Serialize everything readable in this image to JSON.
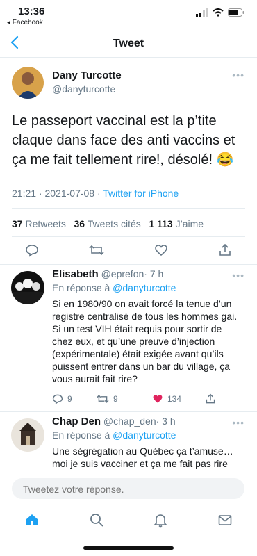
{
  "status": {
    "time": "13:36",
    "back_app": "◂ Facebook"
  },
  "nav": {
    "title": "Tweet"
  },
  "tweet": {
    "author_name": "Dany Turcotte",
    "author_handle": "@danyturcotte",
    "text": "Le passeport vaccinal est la p’tite claque dans face des anti vaccins et ça me fait tellement rire!, désolé! 😂",
    "timestamp": "21:21 · 2021-07-08 · ",
    "source": "Twitter for iPhone",
    "retweets_count": "37",
    "retweets_label": "Retweets",
    "quotes_count": "36",
    "quotes_label": "Tweets cités",
    "likes_count": "1 113",
    "likes_label": "J’aime"
  },
  "replies": [
    {
      "name": "Elisabeth",
      "handle": "@eprefon",
      "time": "· 7 h",
      "in_reply_prefix": "En réponse à ",
      "in_reply_to": "@danyturcotte",
      "text": "Si en 1980/90 on avait forcé la tenue d’un registre centralisé de tous les hommes gai. Si un test VIH était requis pour sortir de chez eux, et qu’une preuve d’injection (expérimentale) était exigée avant qu’ils puissent entrer dans un bar du village, ça vous aurait fait rire?",
      "reply_count": "9",
      "retweet_count": "9",
      "like_count": "134"
    },
    {
      "name": "Chap Den",
      "handle": "@chap_den",
      "time": "· 3 h",
      "in_reply_prefix": "En réponse à ",
      "in_reply_to": "@danyturcotte",
      "text": "Une ségrégation au Québec ça t’amuse… moi je suis vacciner et ça me fait pas rire"
    }
  ],
  "composer": {
    "placeholder": "Tweetez votre réponse."
  },
  "colors": {
    "accent": "#1da1f2",
    "like": "#e0245e",
    "muted": "#657786"
  }
}
